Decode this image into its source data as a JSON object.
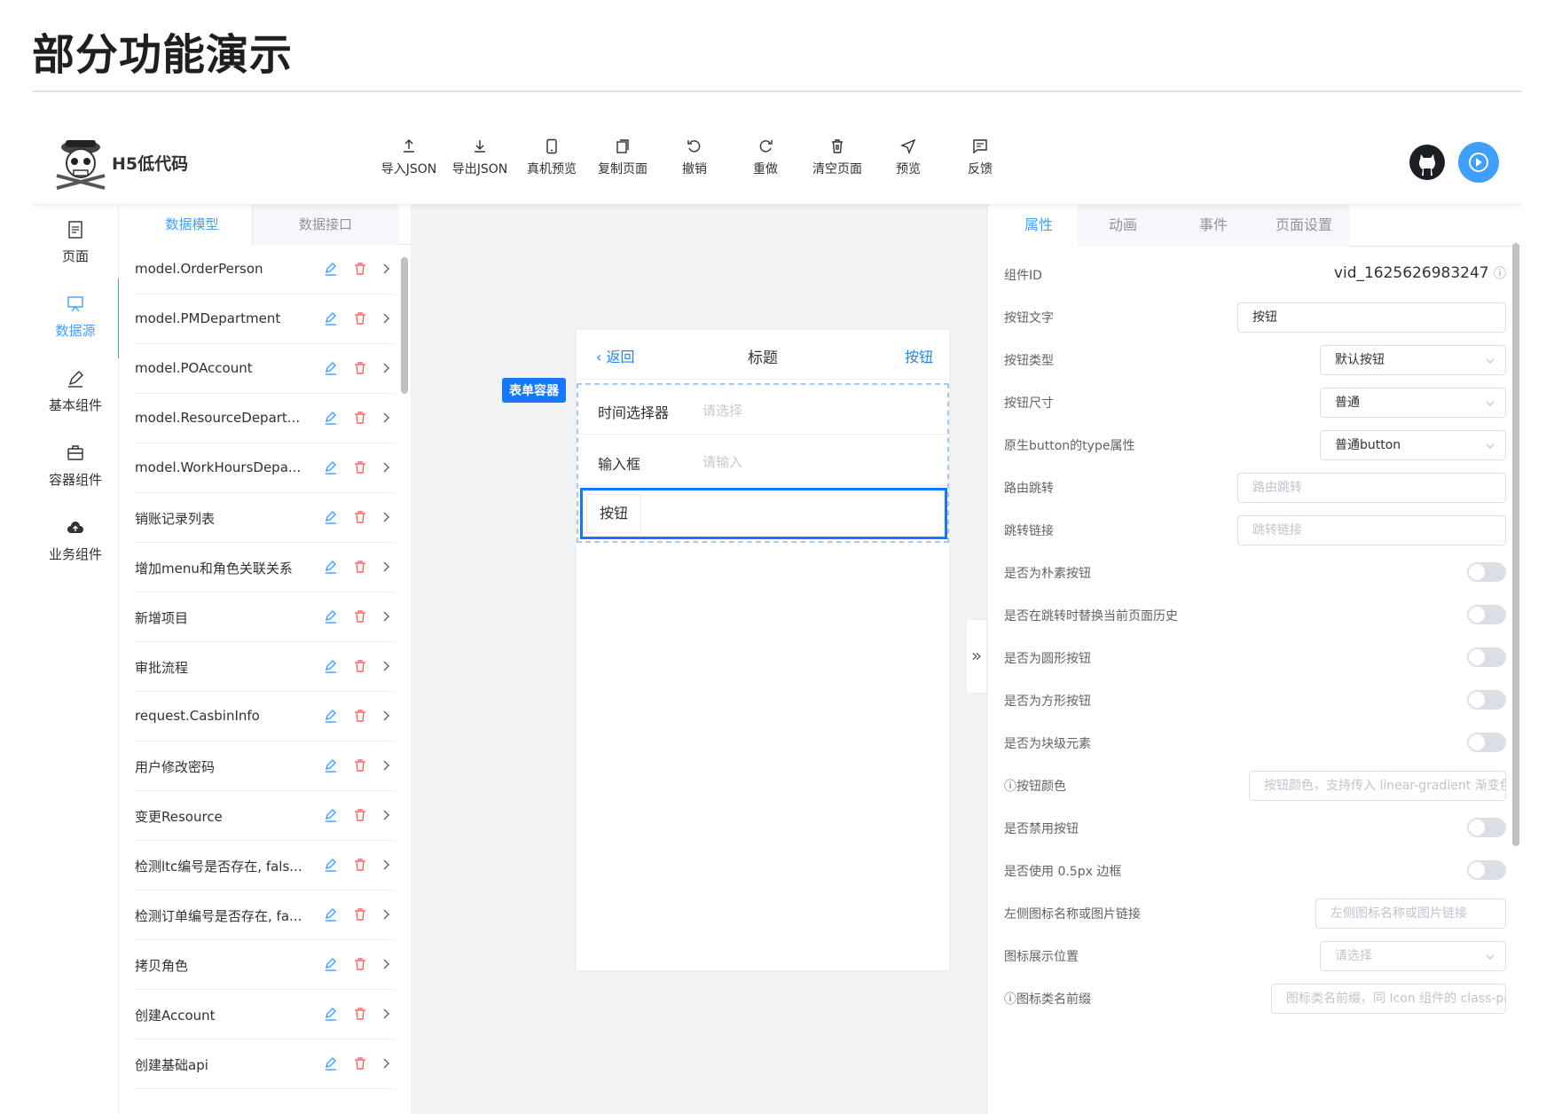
{
  "page": {
    "title": "部分功能演示"
  },
  "app": {
    "brand": "H5低代码",
    "toolbar": [
      {
        "label": "导入JSON",
        "icon": "upload-icon"
      },
      {
        "label": "导出JSON",
        "icon": "download-icon"
      },
      {
        "label": "真机预览",
        "icon": "mobile-icon"
      },
      {
        "label": "复制页面",
        "icon": "copy-icon"
      },
      {
        "label": "撤销",
        "icon": "undo-icon"
      },
      {
        "label": "重做",
        "icon": "redo-icon"
      },
      {
        "label": "清空页面",
        "icon": "trash-icon"
      },
      {
        "label": "预览",
        "icon": "send-icon"
      },
      {
        "label": "反馈",
        "icon": "message-icon"
      }
    ],
    "rail": [
      {
        "label": "页面",
        "icon": "page-icon",
        "active": false
      },
      {
        "label": "数据源",
        "icon": "datasource-icon",
        "active": true
      },
      {
        "label": "基本组件",
        "icon": "pen-icon",
        "active": false
      },
      {
        "label": "容器组件",
        "icon": "box-icon",
        "active": false
      },
      {
        "label": "业务组件",
        "icon": "cloud-icon",
        "active": false
      }
    ],
    "panel_tabs": [
      "数据模型",
      "数据接口"
    ],
    "models": [
      "model.OrderPerson",
      "model.PMDepartment",
      "model.POAccount",
      "model.ResourceDepart...",
      "model.WorkHoursDepa...",
      "销账记录列表",
      "增加menu和角色关联关系",
      "新增项目",
      "审批流程",
      "request.CasbinInfo",
      "用户修改密码",
      "变更Resource",
      "检测ltc编号是否存在, fals...",
      "检测订单编号是否存在, fa...",
      "拷贝角色",
      "创建Account",
      "创建基础api"
    ],
    "phone": {
      "back": "返回",
      "title": "标题",
      "right": "按钮",
      "form_tag": "表单容器",
      "fields": [
        {
          "label": "时间选择器",
          "placeholder": "请选择"
        },
        {
          "label": "输入框",
          "placeholder": "请输入"
        }
      ],
      "button": "按钮"
    },
    "props_tabs": [
      "属性",
      "动画",
      "事件",
      "页面设置"
    ],
    "props": {
      "component_id_label": "组件ID",
      "component_id": "vid_1625626983247",
      "button_text_label": "按钮文字",
      "button_text": "按钮",
      "button_type_label": "按钮类型",
      "button_type": "默认按钮",
      "button_size_label": "按钮尺寸",
      "button_size": "普通",
      "native_type_label": "原生button的type属性",
      "native_type": "普通button",
      "route_label": "路由跳转",
      "route_placeholder": "路由跳转",
      "link_label": "跳转链接",
      "link_placeholder": "跳转链接",
      "plain_label": "是否为朴素按钮",
      "replace_label": "是否在跳转时替换当前页面历史",
      "round_label": "是否为圆形按钮",
      "square_label": "是否为方形按钮",
      "block_label": "是否为块级元素",
      "color_label": "ⓘ按钮颜色",
      "color_placeholder": "按钮颜色，支持传入 linear-gradient 渐变色",
      "disabled_label": "是否禁用按钮",
      "hairline_label": "是否使用 0.5px 边框",
      "icon_label": "左侧图标名称或图片链接",
      "icon_placeholder": "左侧图标名称或图片链接",
      "icon_pos_label": "图标展示位置",
      "icon_pos_placeholder": "请选择",
      "icon_prefix_label": "ⓘ图标类名前缀",
      "icon_prefix_placeholder": "图标类名前缀，同 Icon 组件的 class-pref"
    },
    "colors": {
      "accent": "#409eff",
      "selection": "#1677ff",
      "delete": "#f56c6c"
    }
  }
}
